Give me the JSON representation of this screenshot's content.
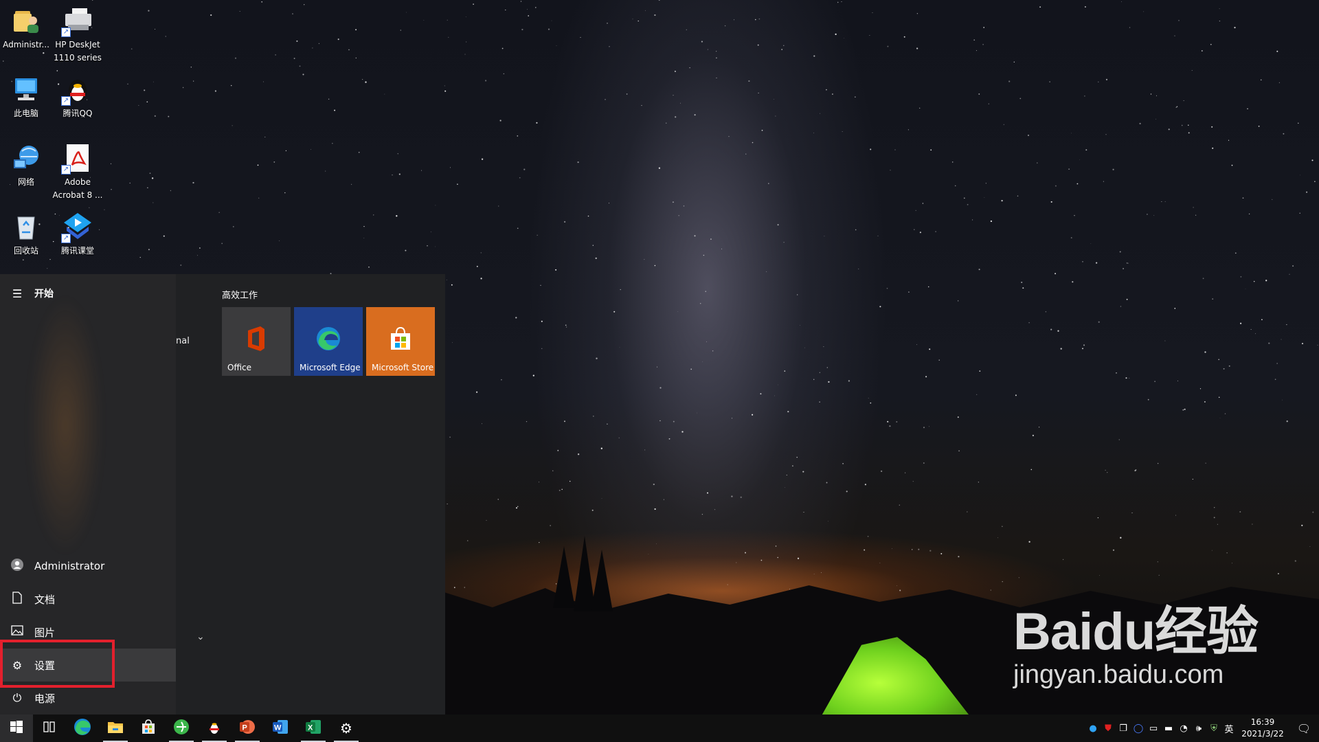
{
  "desktop": {
    "icons": [
      {
        "label": "Administr...",
        "icon": "user-folder-icon"
      },
      {
        "label": "HP DeskJet\n1110 series",
        "icon": "printer-icon"
      },
      {
        "label": "此电脑",
        "icon": "computer-icon"
      },
      {
        "label": "腾讯QQ",
        "icon": "qq-penguin-icon"
      },
      {
        "label": "网络",
        "icon": "network-globe-icon"
      },
      {
        "label": "Adobe\nAcrobat 8 ...",
        "icon": "acrobat-pdf-icon"
      },
      {
        "label": "回收站",
        "icon": "recycle-bin-icon"
      },
      {
        "label": "腾讯课堂",
        "icon": "tencent-classroom-icon"
      }
    ]
  },
  "start_menu": {
    "title": "开始",
    "rail_items": [
      {
        "label": "Administrator",
        "icon": "user-icon"
      },
      {
        "label": "文档",
        "icon": "document-icon"
      },
      {
        "label": "图片",
        "icon": "pictures-icon"
      },
      {
        "label": "设置",
        "icon": "gear-icon",
        "active": true
      },
      {
        "label": "电源",
        "icon": "power-icon"
      }
    ],
    "app_list_peek": "nal",
    "tile_group": "高效工作",
    "tiles": [
      {
        "label": "Office",
        "color": "#3b3b3d",
        "icon": "office-icon"
      },
      {
        "label": "Microsoft Edge",
        "color": "#1f3f8a",
        "icon": "edge-icon"
      },
      {
        "label": "Microsoft Store",
        "color": "#d96d1f",
        "icon": "store-icon"
      }
    ],
    "highlight_color": "#e3202d"
  },
  "taskbar": {
    "apps": [
      {
        "name": "task-view",
        "icon": "task-view-icon"
      },
      {
        "name": "edge",
        "icon": "edge-icon"
      },
      {
        "name": "file-explorer",
        "icon": "folder-icon"
      },
      {
        "name": "store",
        "icon": "store-icon"
      },
      {
        "name": "browser-360",
        "icon": "browser-360-icon"
      },
      {
        "name": "qq",
        "icon": "qq-penguin-icon"
      },
      {
        "name": "powerpoint",
        "icon": "powerpoint-icon"
      },
      {
        "name": "word",
        "icon": "word-icon"
      },
      {
        "name": "excel",
        "icon": "excel-icon"
      },
      {
        "name": "settings",
        "icon": "gear-icon"
      }
    ],
    "ime": "英",
    "time": "16:39",
    "date": "2021/3/22"
  },
  "watermark": {
    "logo": "Baidu经验",
    "url": "jingyan.baidu.com"
  }
}
